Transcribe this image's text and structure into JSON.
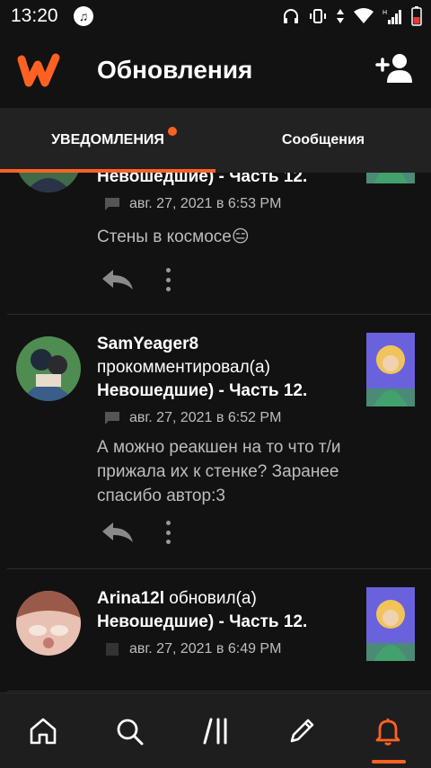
{
  "status_bar": {
    "time": "13:20"
  },
  "header": {
    "title": "Обновления"
  },
  "tabs": [
    {
      "label": "УВЕДОМЛЕНИЯ",
      "active": true,
      "has_badge": true
    },
    {
      "label": "Сообщения",
      "active": false
    }
  ],
  "notifications": [
    {
      "story_title": "Невошедшие) - Часть 12.",
      "timestamp": "авг. 27, 2021 в 6:53 PM",
      "comment": "Стены в космосе😑"
    },
    {
      "user": "SamYeager8",
      "action": "прокомментировал(а)",
      "story_title": "Невошедшие) - Часть 12.",
      "timestamp": "авг. 27, 2021 в 6:52 PM",
      "comment": "А можно реакшен на то что т/и прижала их к стенке? Заранее спасибо автор:3"
    },
    {
      "user": "Arina12l",
      "action": "обновил(а)",
      "story_title": "Невошедшие) - Часть 12.",
      "timestamp": "авг. 27, 2021 в 6:49 PM"
    }
  ],
  "bottom_nav": [
    {
      "icon": "home-icon"
    },
    {
      "icon": "search-icon"
    },
    {
      "icon": "library-icon"
    },
    {
      "icon": "pencil-icon"
    },
    {
      "icon": "bell-icon",
      "active": true
    }
  ],
  "colors": {
    "accent": "#ff6122",
    "background": "#121212",
    "tab_bar": "#222222",
    "muted_text": "#bdbdbd"
  }
}
